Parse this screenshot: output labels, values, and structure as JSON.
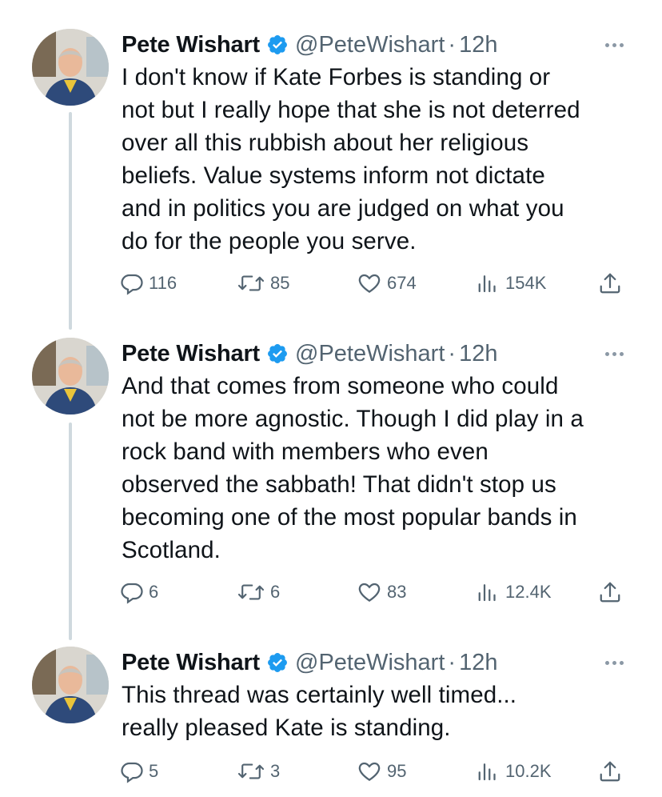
{
  "tweets": [
    {
      "author_name": "Pete Wishart",
      "handle": "@PeteWishart",
      "separator": "·",
      "time": "12h",
      "text": "I don't know if Kate Forbes is standing or\nnot but I really hope that she is not deterred\nover all this rubbish about her religious\nbeliefs. Value systems inform not dictate\nand in politics you are judged on what you\ndo for the people you serve.",
      "replies": "116",
      "retweets": "85",
      "likes": "674",
      "views": "154K"
    },
    {
      "author_name": "Pete Wishart",
      "handle": "@PeteWishart",
      "separator": "·",
      "time": "12h",
      "text": "And that comes from someone who could\nnot be more agnostic. Though I did play in a\nrock band with members who even\nobserved the sabbath! That didn't stop us\nbecoming one of the most popular bands in\nScotland.",
      "replies": "6",
      "retweets": "6",
      "likes": "83",
      "views": "12.4K"
    },
    {
      "author_name": "Pete Wishart",
      "handle": "@PeteWishart",
      "separator": "·",
      "time": "12h",
      "text": "This thread was certainly well timed...\nreally pleased Kate is standing.",
      "replies": "5",
      "retweets": "3",
      "likes": "95",
      "views": "10.2K"
    }
  ],
  "icons": {
    "verified": "verified-badge-icon",
    "more": "more-options-icon",
    "reply": "reply-icon",
    "retweet": "retweet-icon",
    "like": "heart-icon",
    "views": "views-chart-icon",
    "share": "share-icon"
  },
  "colors": {
    "text": "#0f1419",
    "secondary": "#536471",
    "verified": "#1d9bf0",
    "thread_line": "#cfd9de"
  }
}
